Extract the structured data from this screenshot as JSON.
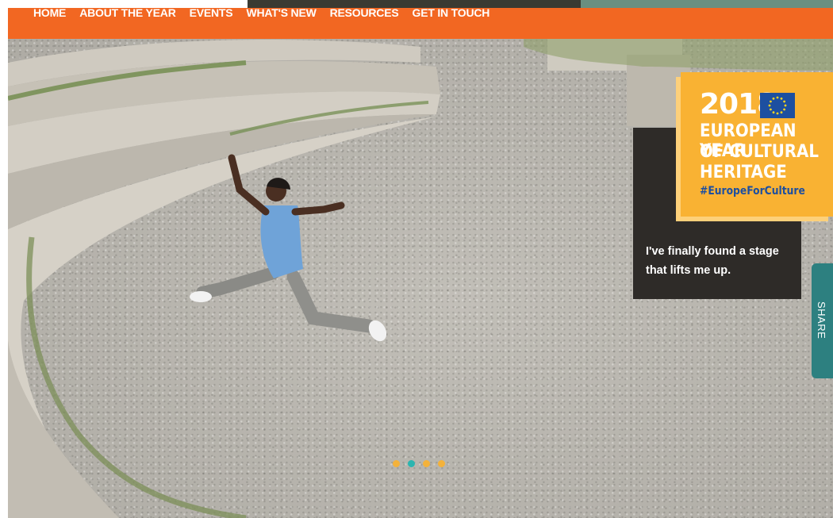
{
  "nav": {
    "items": [
      "HOME",
      "ABOUT THE YEAR",
      "EVENTS",
      "WHAT'S NEW",
      "RESOURCES",
      "GET IN TOUCH"
    ]
  },
  "logo": {
    "year": "2018",
    "line1": "EUROPEAN YEAR",
    "line2": "OF CULTURAL",
    "line3": "HERITAGE",
    "hashtag": "#EuropeForCulture"
  },
  "caption": {
    "quote": "I've finally found a stage that lifts me up."
  },
  "share": {
    "label": "SHARE"
  },
  "slider": {
    "dots": [
      {
        "color": "#f4b23a"
      },
      {
        "color": "#2bb5b0"
      },
      {
        "color": "#f4b23a"
      },
      {
        "color": "#f4b23a"
      }
    ]
  },
  "colors": {
    "nav_bg": "#f26722",
    "logo_bg": "#f9b233",
    "eu_blue": "#1d4fa0",
    "share_bg": "#2d8080",
    "caption_bg": "#2e2b28"
  }
}
